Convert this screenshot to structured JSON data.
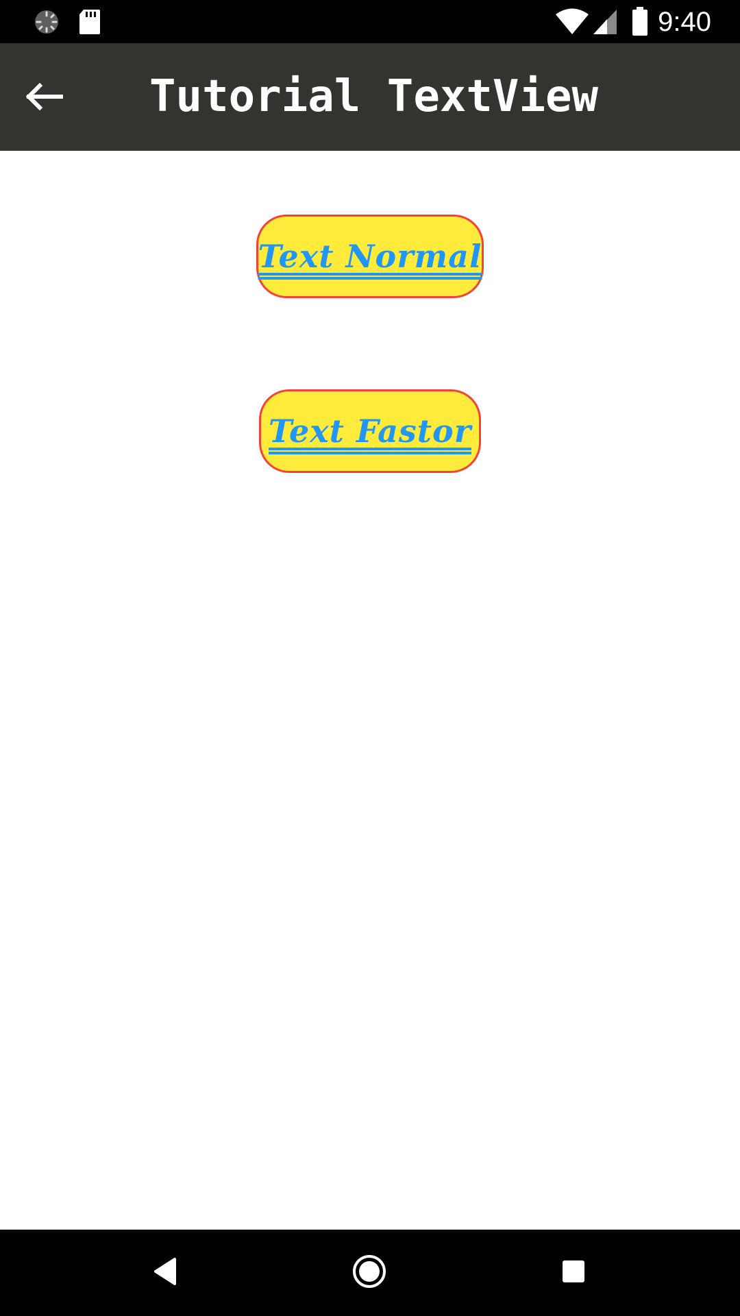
{
  "status_bar": {
    "time": "9:40",
    "left_icons": [
      "sync-spinner-icon",
      "sd-card-icon"
    ],
    "right_icons": [
      "wifi-icon",
      "cell-signal-icon",
      "battery-icon"
    ]
  },
  "app_bar": {
    "title": "Tutorial TextView",
    "back_icon": "back-arrow-icon"
  },
  "buttons": {
    "normal_label": "Text Normal",
    "fastor_label": "Text Fastor"
  },
  "colors": {
    "status_bar": "#000000",
    "app_bar": "#33332f",
    "button_fill": "#ffeb3b",
    "button_border": "#f44336",
    "button_text": "#2196f3",
    "nav_bar": "#000000"
  },
  "nav_bar": {
    "icons": [
      "nav-back-icon",
      "nav-home-icon",
      "nav-recents-icon"
    ]
  }
}
